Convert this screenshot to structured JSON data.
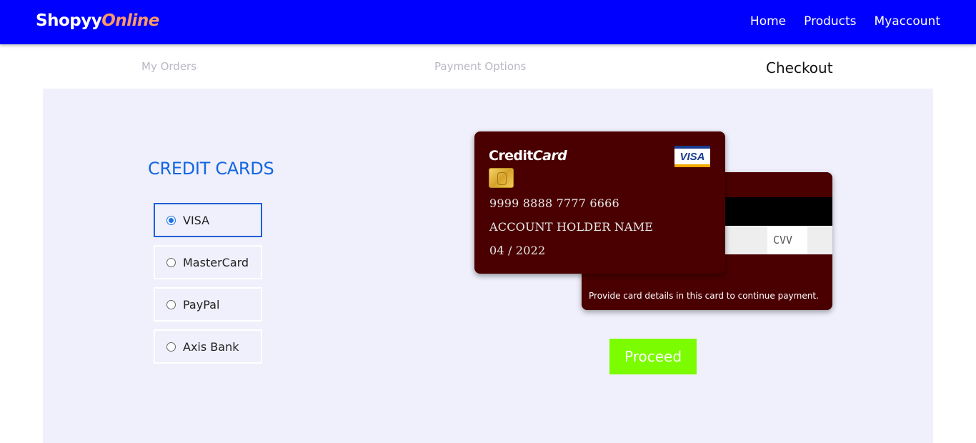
{
  "header": {
    "logo_primary": "Shopyy",
    "logo_accent": "Online",
    "nav": {
      "home": "Home",
      "products": "Products",
      "myaccount": "Myaccount"
    }
  },
  "steps": {
    "orders": "My Orders",
    "payment": "Payment Options",
    "checkout": "Checkout"
  },
  "payment": {
    "title": "CREDIT CARDS",
    "options": [
      {
        "label": "VISA",
        "selected": true
      },
      {
        "label": "MasterCard",
        "selected": false
      },
      {
        "label": "PayPal",
        "selected": false
      },
      {
        "label": "Axis Bank",
        "selected": false
      }
    ]
  },
  "card": {
    "brand_primary": "Credit",
    "brand_accent": "Card",
    "network": "VISA",
    "number": "9999 8888 7777 6666",
    "holder": "ACCOUNT HOLDER NAME",
    "expiry": "04 / 2022",
    "cvv_placeholder": "CVV",
    "note": "Provide card details in this card to continue payment."
  },
  "actions": {
    "proceed": "Proceed"
  },
  "colors": {
    "header_bg": "#0000ff",
    "logo_accent": "#ff9966",
    "panel_bg": "#f0f0fc",
    "card_bg": "#4a0000",
    "proceed_bg": "#7cfc00",
    "title": "#1466e0"
  }
}
